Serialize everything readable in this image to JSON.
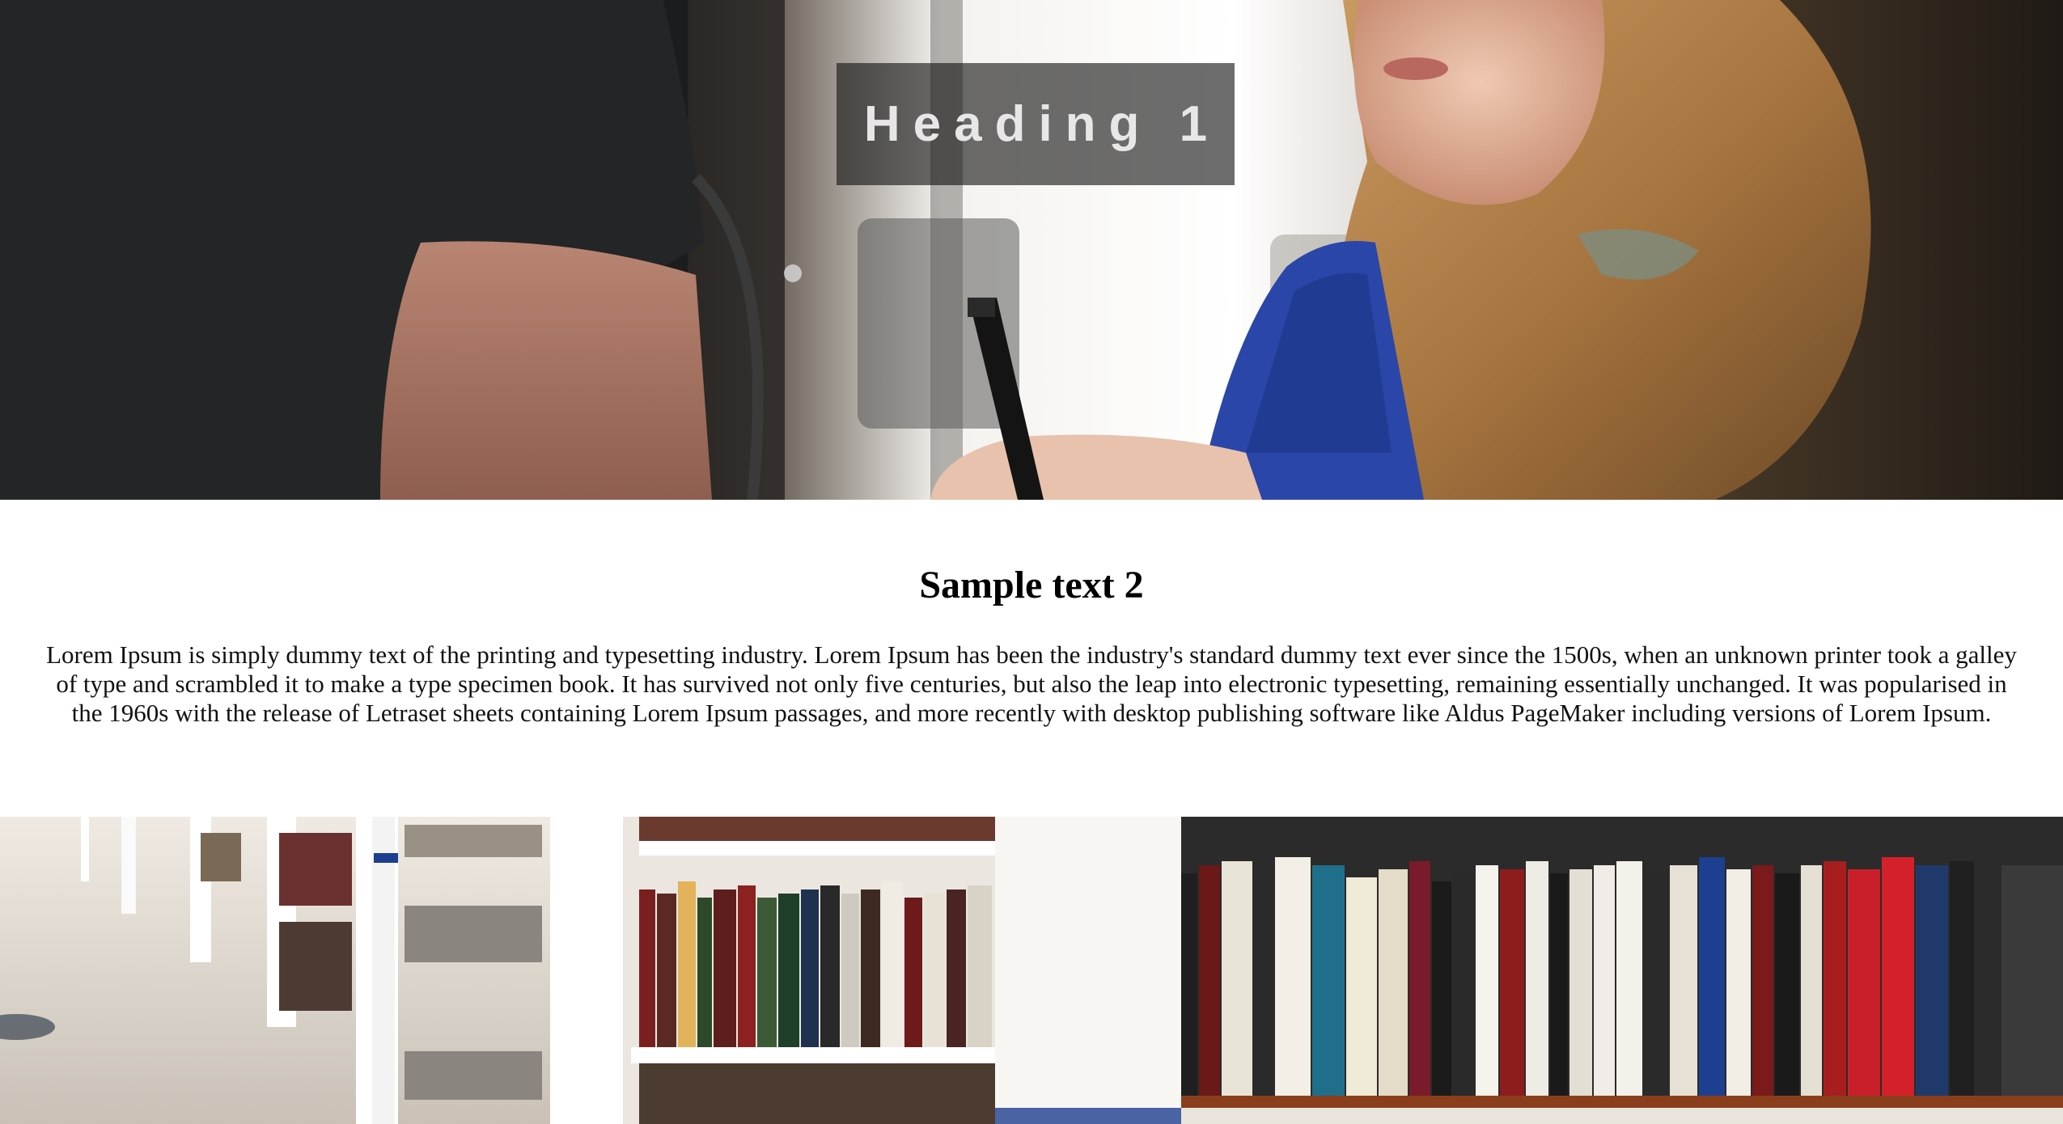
{
  "hero": {
    "heading": "Heading 1"
  },
  "content": {
    "heading": "Sample text 2",
    "body": "Lorem Ipsum is simply dummy text of the printing and typesetting industry. Lorem Ipsum has been the industry's standard dummy text ever since the 1500s, when an unknown printer took a galley of type and scrambled it to make a type specimen book. It has survived not only five centuries, but also the leap into electronic typesetting, remaining essentially unchanged. It was popularised in the 1960s with the release of Letraset sheets containing Lorem Ipsum passages, and more recently with desktop publishing software like Aldus PageMaker including versions of Lorem Ipsum."
  },
  "colors": {
    "page_background": "#ffffff",
    "title_box": "#141414",
    "title_text": "#e7e7e7",
    "body_text": "#111111"
  }
}
